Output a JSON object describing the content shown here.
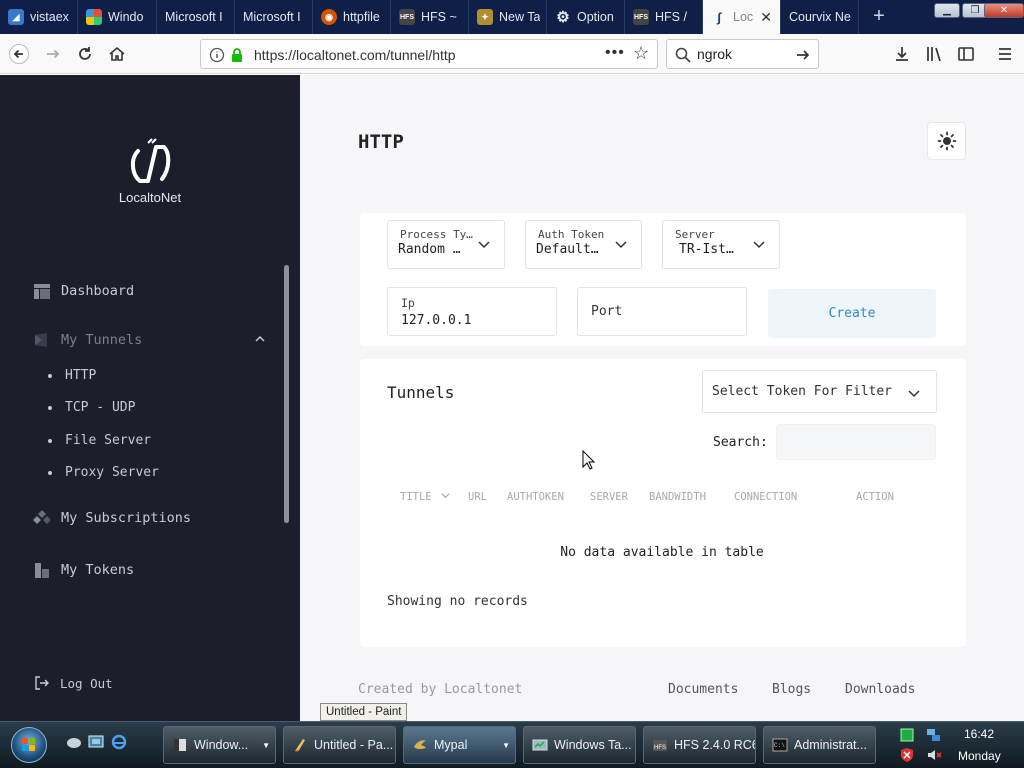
{
  "browser": {
    "tabs": [
      {
        "label": "vistaex",
        "icon": "vista-icon",
        "active": false
      },
      {
        "label": "Windo",
        "icon": "windows-icon",
        "active": false
      },
      {
        "label": "Microsoft I",
        "icon": "none",
        "active": false
      },
      {
        "label": "Microsoft I",
        "icon": "none",
        "active": false
      },
      {
        "label": "httpfile",
        "icon": "httpfile-icon",
        "active": false
      },
      {
        "label": "HFS ~",
        "icon": "hfs-icon",
        "active": false
      },
      {
        "label": "New Ta",
        "icon": "mypal-icon",
        "active": false
      },
      {
        "label": "Option",
        "icon": "gear-icon",
        "active": false
      },
      {
        "label": "HFS /",
        "icon": "hfs-icon",
        "active": false
      },
      {
        "label": "Loc",
        "icon": "localtonet-icon",
        "active": true
      },
      {
        "label": "Courvix Ne",
        "icon": "none",
        "active": false
      }
    ],
    "url": "https://localtonet.com/tunnel/http",
    "search_value": "ngrok"
  },
  "sidebar": {
    "logo_text": "LocaltoNet",
    "dashboard": "Dashboard",
    "my_tunnels": "My Tunnels",
    "tunnel_items": [
      "HTTP",
      "TCP - UDP",
      "File Server",
      "Proxy Server"
    ],
    "my_subscriptions": "My Subscriptions",
    "my_tokens": "My Tokens",
    "logout": "Log Out"
  },
  "main": {
    "title": "HTTP",
    "form": {
      "process_type": {
        "label": "Process Ty…",
        "value": "Random …"
      },
      "auth_token": {
        "label": "Auth Token",
        "value": "Default…"
      },
      "server": {
        "label": "Server",
        "value": "TR-Ist…"
      },
      "ip": {
        "label": "Ip",
        "value": "127.0.0.1"
      },
      "port": {
        "label": "Port",
        "value": ""
      },
      "create_label": "Create"
    },
    "tunnels": {
      "title": "Tunnels",
      "filter_placeholder": "Select Token For Filter",
      "search_label": "Search:",
      "columns": [
        "TITLE",
        "URL",
        "AUTHTOKEN",
        "SERVER",
        "BANDWIDTH",
        "CONNECTION",
        "ACTION"
      ],
      "empty_message": "No data available in table",
      "showing": "Showing no records"
    },
    "footer": {
      "created_by": "Created by Localtonet",
      "links": [
        "Documents",
        "Blogs",
        "Downloads"
      ]
    }
  },
  "tooltip": "Untitled - Paint",
  "taskbar": {
    "buttons": [
      {
        "label": "Window...",
        "active": false
      },
      {
        "label": "Untitled - Pa...",
        "active": false
      },
      {
        "label": "Mypal",
        "active": true
      },
      {
        "label": "Windows Ta...",
        "active": false
      },
      {
        "label": "HFS 2.4.0 RC6",
        "active": false
      },
      {
        "label": "Administrat...",
        "active": false
      }
    ],
    "time": "16:42",
    "day": "Monday"
  },
  "colors": {
    "tabstrip": "#0f1f47",
    "sidebar": "#1c1e2c",
    "accent": "#2f8cc8",
    "content_bg": "#f6f6f9"
  }
}
